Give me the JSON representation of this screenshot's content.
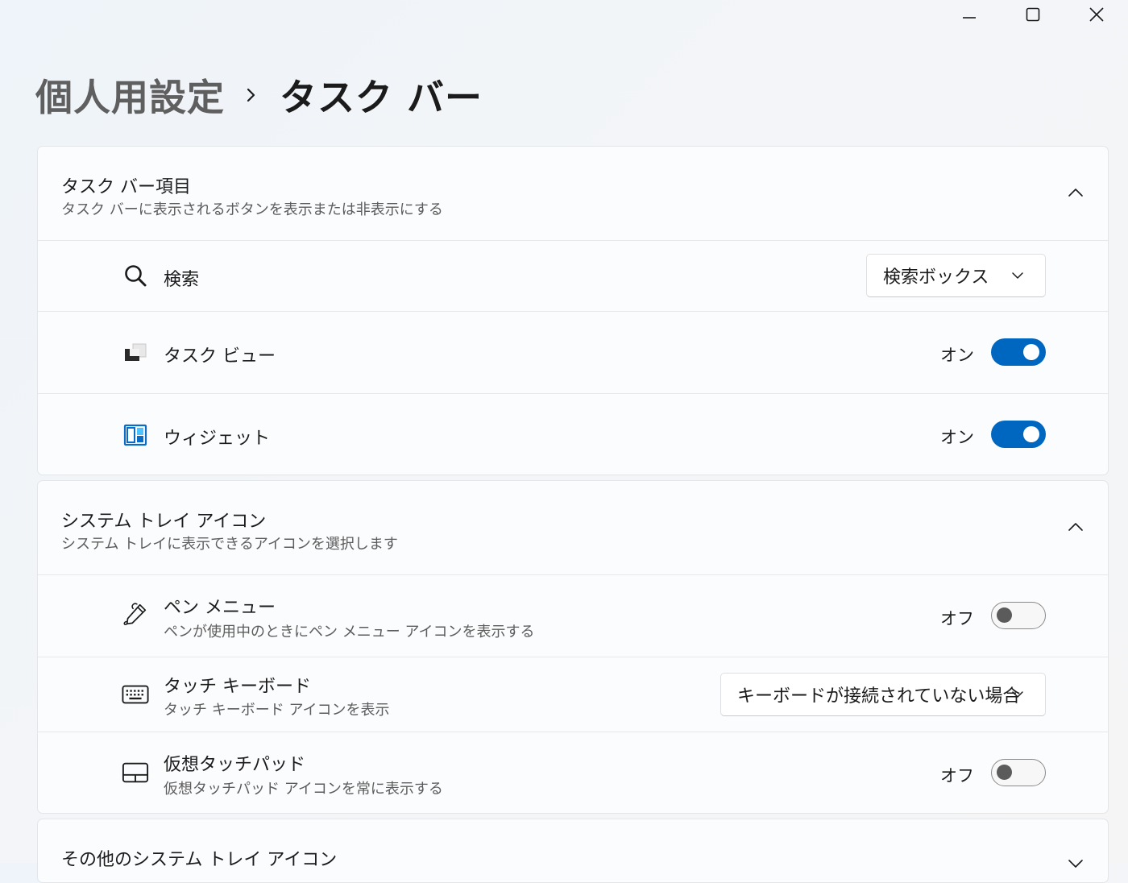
{
  "page": {
    "breadcrumb_parent": "個人用設定",
    "breadcrumb_current": "タスク バー"
  },
  "window_controls": {
    "minimize_icon": "minimize-icon",
    "maximize_icon": "maximize-icon",
    "close_icon": "close-icon"
  },
  "taskbar_items": {
    "title": "タスク バー項目",
    "subtitle": "タスク バーに表示されるボタンを表示または非表示にする",
    "rows": [
      {
        "icon": "search-icon",
        "label": "検索",
        "control": "dropdown",
        "value": "検索ボックス"
      },
      {
        "icon": "task-view-icon",
        "label": "タスク ビュー",
        "control": "toggle",
        "state_text": "オン",
        "on": true
      },
      {
        "icon": "widgets-icon",
        "label": "ウィジェット",
        "control": "toggle",
        "state_text": "オン",
        "on": true
      }
    ]
  },
  "system_tray": {
    "title": "システム トレイ アイコン",
    "subtitle": "システム トレイに表示できるアイコンを選択します",
    "rows": [
      {
        "icon": "pen-icon",
        "label": "ペン メニュー",
        "description": "ペンが使用中のときにペン メニュー アイコンを表示する",
        "control": "toggle",
        "state_text": "オフ",
        "on": false
      },
      {
        "icon": "keyboard-icon",
        "label": "タッチ キーボード",
        "description": "タッチ キーボード アイコンを表示",
        "control": "dropdown",
        "value": "キーボードが接続されていない場合"
      },
      {
        "icon": "touchpad-icon",
        "label": "仮想タッチパッド",
        "description": "仮想タッチパッド アイコンを常に表示する",
        "control": "toggle",
        "state_text": "オフ",
        "on": false
      }
    ]
  },
  "other_tray": {
    "title": "その他のシステム トレイ アイコン"
  },
  "colors": {
    "accent": "#0067c0",
    "toggle_off_knob": "#5b5b5b",
    "background": "#f3f5f8"
  }
}
